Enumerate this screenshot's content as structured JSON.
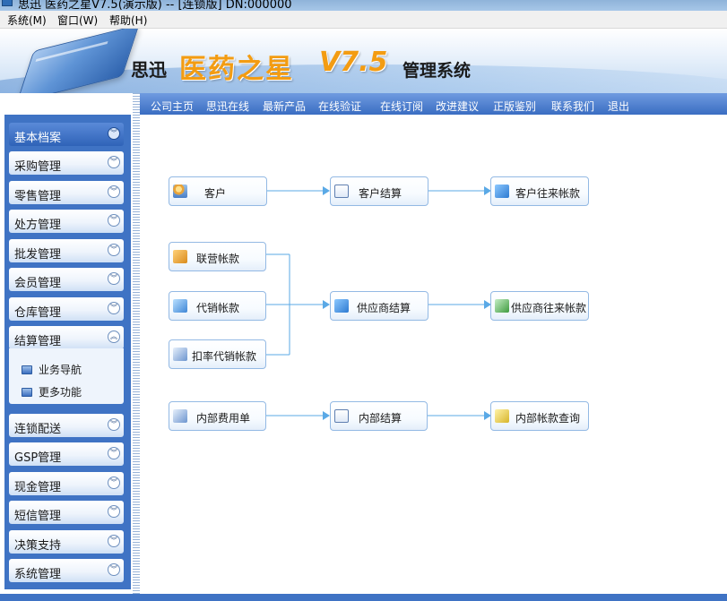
{
  "window": {
    "title": "思迅 医药之星V7.5(演示版) -- [连锁版] DN:000000"
  },
  "menubar": {
    "items": [
      "系统(M)",
      "窗口(W)",
      "帮助(H)"
    ]
  },
  "banner": {
    "brand": "思迅",
    "product": "医药之星",
    "version": "V7.5",
    "subtitle": "管理系统"
  },
  "topnav": {
    "items": [
      "公司主页",
      "思迅在线",
      "最新产品",
      "在线验证",
      "在线订阅",
      "改进建议",
      "正版鉴别",
      "联系我们",
      "退出"
    ]
  },
  "sidebar": {
    "items": [
      {
        "label": "基本档案",
        "state": "selected"
      },
      {
        "label": "采购管理",
        "state": "collapsed"
      },
      {
        "label": "零售管理",
        "state": "collapsed"
      },
      {
        "label": "处方管理",
        "state": "collapsed"
      },
      {
        "label": "批发管理",
        "state": "collapsed"
      },
      {
        "label": "会员管理",
        "state": "collapsed"
      },
      {
        "label": "仓库管理",
        "state": "collapsed"
      },
      {
        "label": "结算管理",
        "state": "expanded"
      },
      {
        "label": "连锁配送",
        "state": "collapsed"
      },
      {
        "label": "GSP管理",
        "state": "collapsed"
      },
      {
        "label": "现金管理",
        "state": "collapsed"
      },
      {
        "label": "短信管理",
        "state": "collapsed"
      },
      {
        "label": "决策支持",
        "state": "collapsed"
      },
      {
        "label": "系统管理",
        "state": "collapsed"
      }
    ],
    "submenu": [
      "业务导航",
      "更多功能"
    ]
  },
  "flow": {
    "customer": "客户",
    "customer_settle": "客户结算",
    "customer_account": "客户往来帐款",
    "joint_account": "联营帐款",
    "consign_account": "代销帐款",
    "deduct_consign": "扣率代销帐款",
    "supplier_settle": "供应商结算",
    "supplier_account": "供应商往来帐款",
    "internal_expense": "内部费用单",
    "internal_settle": "内部结算",
    "internal_query": "内部帐款查询"
  },
  "colors": {
    "sidebar_bg": "#3f73c4",
    "nav_bg": "#3a6dc2",
    "brand_orange": "#f39c12",
    "connector": "#5aa9e6"
  }
}
